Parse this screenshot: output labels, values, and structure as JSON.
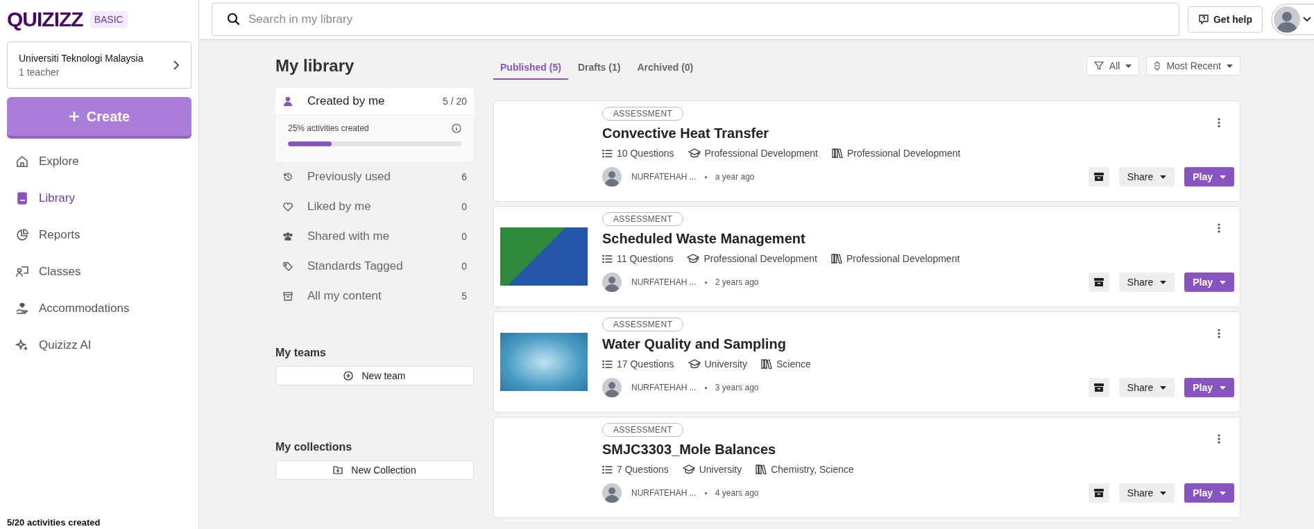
{
  "sidebar": {
    "logo": "QUIZIZZ",
    "plan_badge": "BASIC",
    "organization": {
      "name": "Universiti Teknologi Malaysia",
      "subtitle": "1 teacher"
    },
    "create_button": "Create",
    "items": [
      {
        "label": "Explore",
        "selected": false
      },
      {
        "label": "Library",
        "selected": true
      },
      {
        "label": "Reports",
        "selected": false
      },
      {
        "label": "Classes",
        "selected": false
      },
      {
        "label": "Accommodations",
        "selected": false
      },
      {
        "label": "Quizizz AI",
        "selected": false
      }
    ],
    "footer_note": "5/20 activities created"
  },
  "topbar": {
    "search": {
      "placeholder": "Search in my library"
    },
    "help_button": "Get help"
  },
  "library": {
    "title": "My library",
    "created": {
      "label": "Created by me",
      "count": "5 / 20",
      "selected": true,
      "progress_label": "25% activities created",
      "level": 0.25
    },
    "filters": [
      {
        "label": "Previously used",
        "count": "6",
        "selected": false
      },
      {
        "label": "Liked by me",
        "count": "0",
        "selected": false
      },
      {
        "label": "Shared with me",
        "count": "0",
        "selected": false
      },
      {
        "label": "Standards Tagged",
        "count": "0",
        "selected": false
      },
      {
        "label": "All my content",
        "count": "5",
        "selected": false
      }
    ],
    "teams": {
      "heading": "My teams",
      "button": "New team"
    },
    "collections": {
      "heading": "My collections",
      "button": "New Collection"
    }
  },
  "tabs": [
    {
      "label": "Published (5)",
      "selected": true
    },
    {
      "label": "Drafts (1)",
      "selected": false
    },
    {
      "label": "Archived (0)",
      "selected": false
    }
  ],
  "toolbar": {
    "filter": "All",
    "sort": "Most Recent"
  },
  "cards": [
    {
      "tag": "ASSESSMENT",
      "title": "Convective Heat Transfer",
      "questions": "10 Questions",
      "grade": "Professional Development",
      "subject": "Professional Development",
      "author": "NURFATEHAH ...",
      "time": "a year ago",
      "thumbnail": false,
      "share": "Share",
      "play": "Play"
    },
    {
      "tag": "ASSESSMENT",
      "title": "Scheduled Waste Management",
      "questions": "11 Questions",
      "grade": "Professional Development",
      "subject": "Professional Development",
      "author": "NURFATEHAH ...",
      "time": "2 years ago",
      "thumbnail": true,
      "share": "Share",
      "play": "Play"
    },
    {
      "tag": "ASSESSMENT",
      "title": "Water Quality and Sampling",
      "questions": "17 Questions",
      "grade": "University",
      "subject": "Science",
      "author": "NURFATEHAH ...",
      "time": "3 years ago",
      "thumbnail": true,
      "share": "Share",
      "play": "Play"
    },
    {
      "tag": "ASSESSMENT",
      "title": "SMJC3303_Mole Balances",
      "questions": "7 Questions",
      "grade": "University",
      "subject": "Chemistry, Science",
      "author": "NURFATEHAH ...",
      "time": "4 years ago",
      "thumbnail": false,
      "share": "Share",
      "play": "Play"
    }
  ]
}
